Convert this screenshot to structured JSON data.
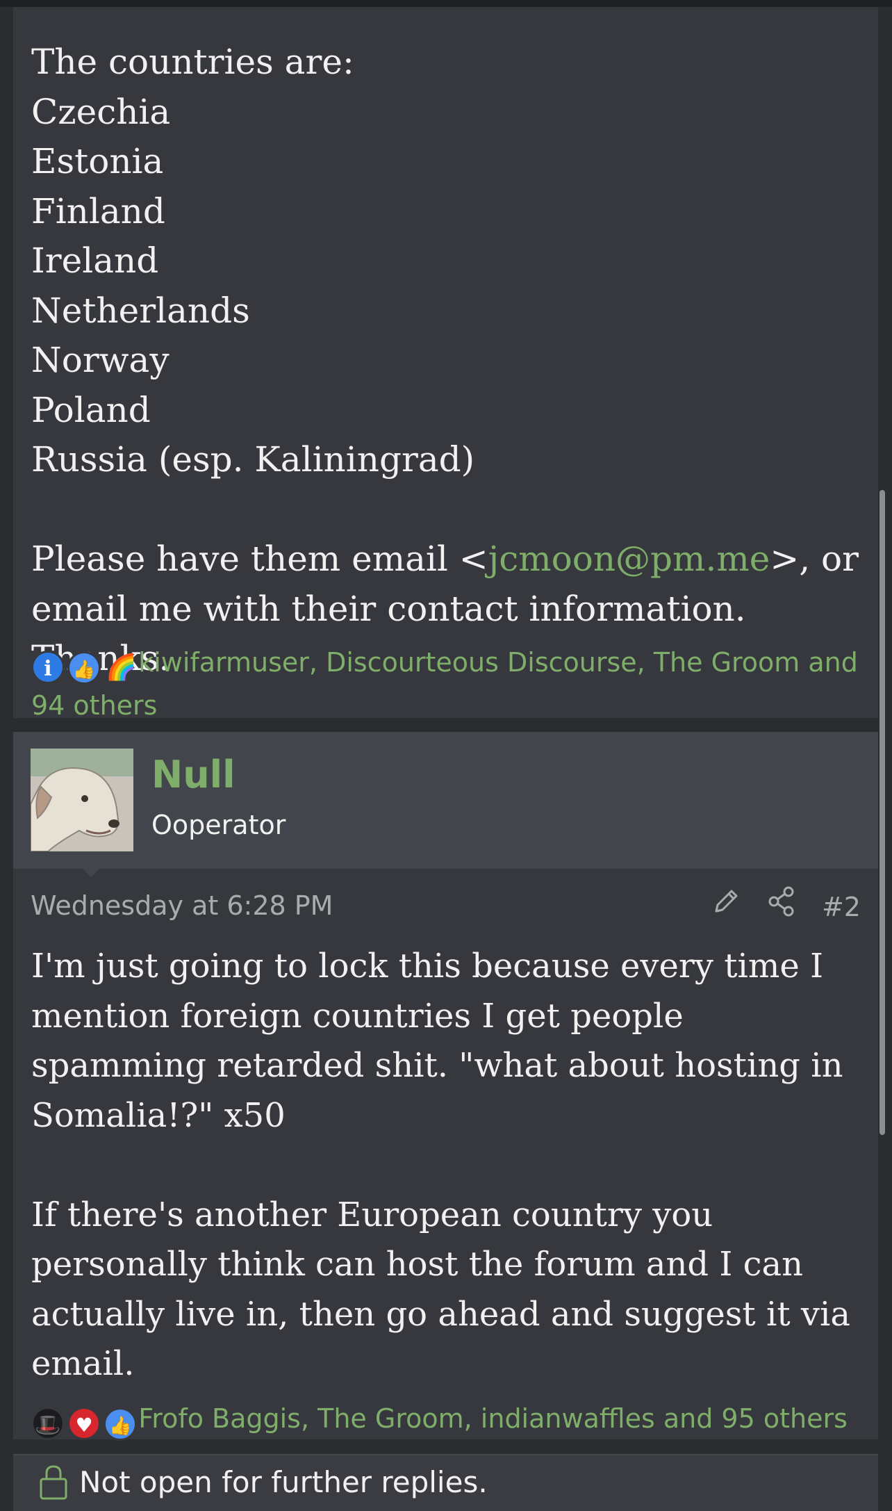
{
  "post1": {
    "intro": "The countries are:",
    "countries": [
      "Czechia",
      "Estonia",
      "Finland",
      "Ireland",
      "Netherlands",
      "Norway",
      "Poland",
      "Russia (esp. Kaliningrad)"
    ],
    "email_line_prefix": "Please have them email <",
    "email": "jcmoon@pm.me",
    "email_line_suffix": ">, or",
    "email_line2": "email me with their contact information. Thanks.",
    "reaction_icons": [
      "informative-icon",
      "like-icon",
      "rainbow-icon"
    ],
    "reaction_text": "kiwifarmuser, Discourteous Discourse, The Groom and 94 others"
  },
  "post2": {
    "username": "Null",
    "user_title": "Ooperator",
    "timestamp": "Wednesday at 6:28 PM",
    "post_number": "#2",
    "paragraph1": "I'm just going to lock this because every time I mention foreign countries I get people spamming retarded shit. \"what about hosting in Somalia!?\" x50",
    "paragraph2": "If there's another European country you personally think can host the forum and I can actually live in, then go ahead and suggest it via email.",
    "reaction_icons": [
      "top-hat-icon",
      "heart-icon",
      "like-icon"
    ],
    "reaction_text": "Frofo Baggis, The Groom, indianwaffles and 95 others"
  },
  "thread_status": {
    "locked_text": "Not open for further replies."
  },
  "colors": {
    "accent_green": "#7fae6a",
    "post_bg": "#36383d",
    "header_bg": "#42454c"
  }
}
